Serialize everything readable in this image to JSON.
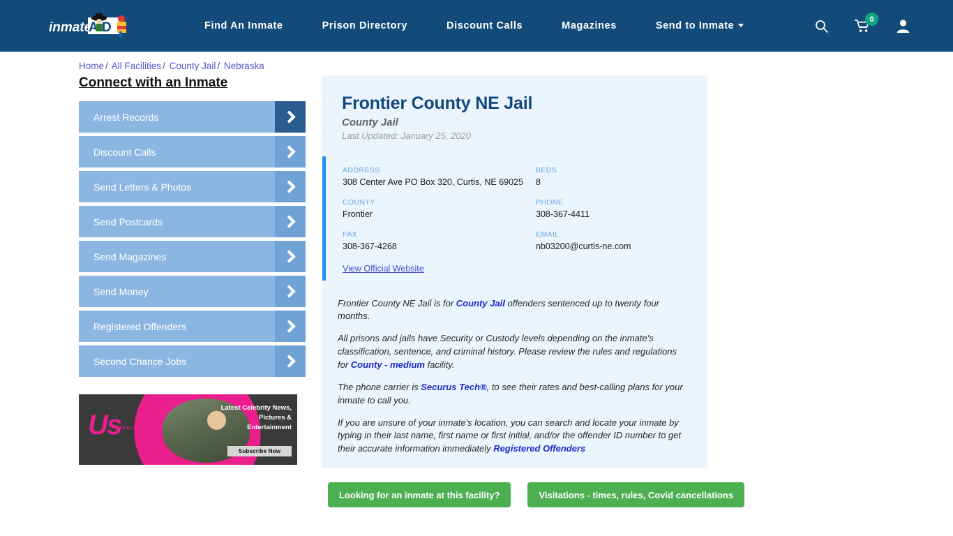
{
  "navbar": {
    "logo_text": "inmate",
    "logo_text2": "AID",
    "links": [
      {
        "label": "Find An Inmate",
        "has_caret": false
      },
      {
        "label": "Prison Directory",
        "has_caret": false
      },
      {
        "label": "Discount Calls",
        "has_caret": false
      },
      {
        "label": "Magazines",
        "has_caret": false
      },
      {
        "label": "Send to Inmate",
        "has_caret": true
      }
    ],
    "search_icon": "search-icon",
    "cart_icon": "shopping-cart-icon",
    "cart_count": "0",
    "account_icon": "user-account-icon",
    "bg_color": "#124a7a",
    "badge_color": "#13a383"
  },
  "breadcrumb": {
    "items": [
      "Home",
      "All Facilities",
      "County Jail",
      "Nebraska"
    ],
    "separator": "/"
  },
  "sidebar": {
    "title": "Connect with an Inmate",
    "items": [
      {
        "label": "Arrest Records",
        "active": true
      },
      {
        "label": "Discount Calls",
        "active": false
      },
      {
        "label": "Send Letters & Photos",
        "active": false
      },
      {
        "label": "Send Postcards",
        "active": false
      },
      {
        "label": "Send Magazines",
        "active": false
      },
      {
        "label": "Send Money",
        "active": false
      },
      {
        "label": "Registered Offenders",
        "active": false
      },
      {
        "label": "Second Chance Jobs",
        "active": false
      }
    ],
    "ad": {
      "brand": "Us",
      "brand_sub": "WEEKLY",
      "headline": "Latest Celebrity News, Pictures & Entertainment",
      "button_label": "Subscribe Now"
    }
  },
  "facility": {
    "name": "Frontier County NE Jail",
    "type": "County Jail",
    "last_updated": "Last Updated: January 25, 2020",
    "info": [
      {
        "label": "ADDRESS",
        "value": "308 Center Ave PO Box 320, Curtis, NE 69025"
      },
      {
        "label": "BEDS",
        "value": "8"
      },
      {
        "label": "COUNTY",
        "value": "Frontier"
      },
      {
        "label": "PHONE",
        "value": "308-367-4411"
      },
      {
        "label": "FAX",
        "value": "308-367-4268"
      },
      {
        "label": "EMAIL",
        "value": "nb03200@curtis-ne.com"
      }
    ],
    "official_website_label": "View Official Website",
    "accent_color": "#1e90ef",
    "paragraphs": [
      {
        "parts": [
          {
            "text": "Frontier County NE Jail is for ",
            "link": false
          },
          {
            "text": "County Jail",
            "link": true
          },
          {
            "text": " offenders sentenced up to twenty four months.",
            "link": false
          }
        ]
      },
      {
        "parts": [
          {
            "text": "All prisons and jails have Security or Custody levels depending on the inmate's classification, sentence, and criminal history. Please review the rules and regulations for ",
            "link": false
          },
          {
            "text": "County - medium",
            "link": true
          },
          {
            "text": " facility.",
            "link": false
          }
        ]
      },
      {
        "parts": [
          {
            "text": "The phone carrier is ",
            "link": false
          },
          {
            "text": "Securus Tech®",
            "link": true
          },
          {
            "text": ", to see their rates and best-calling plans for your inmate to call you.",
            "link": false
          }
        ]
      },
      {
        "parts": [
          {
            "text": "If you are unsure of your inmate's location, you can search and locate your inmate by typing in their last name, first name or first initial, and/or the offender ID number to get their accurate information immediately ",
            "link": false
          },
          {
            "text": "Registered Offenders",
            "link": true
          }
        ]
      }
    ],
    "cta": [
      {
        "label": "Looking for an inmate at this facility?"
      },
      {
        "label": "Visitations - times, rules, Covid cancellations"
      }
    ],
    "cta_color": "#4caf50"
  }
}
